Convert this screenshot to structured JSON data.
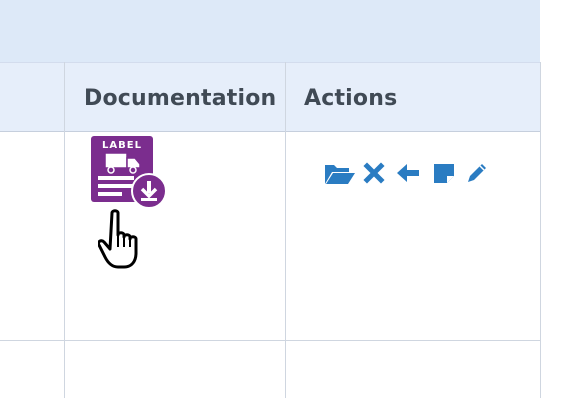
{
  "table": {
    "columns": {
      "documentation": "Documentation",
      "actions": "Actions"
    },
    "rows": [
      {
        "documentation": {
          "icon": "shipping-label-download-icon",
          "icon_text": "LABEL",
          "icon_color": "#7b2d8e"
        },
        "actions": [
          {
            "icon": "folder-open-icon"
          },
          {
            "icon": "close-icon"
          },
          {
            "icon": "arrow-left-icon"
          },
          {
            "icon": "note-icon"
          },
          {
            "icon": "pencil-icon"
          }
        ]
      }
    ]
  },
  "colors": {
    "header_band": "#dde9f8",
    "header_row": "#e6eefa",
    "action_icon": "#2a7cc2",
    "label_icon": "#7b2d8e"
  }
}
